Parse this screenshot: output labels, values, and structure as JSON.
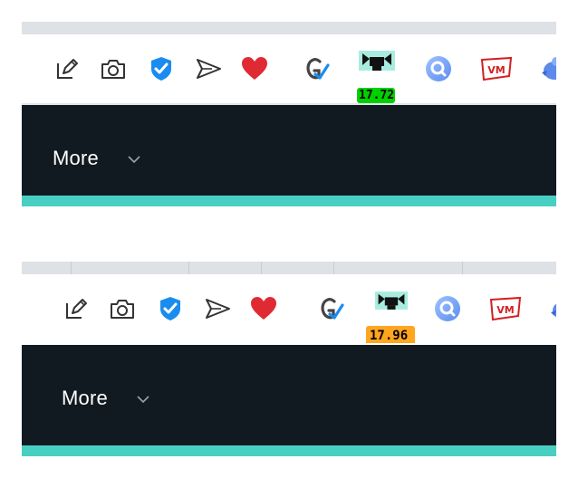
{
  "colors": {
    "navbar_bg": "#111a21",
    "accent_bar": "#47cfc1",
    "tabstrip_bg": "#dee1e6",
    "shield_blue": "#1a8cf0",
    "heart_red": "#e02a33",
    "badge_green": "#00d000",
    "badge_orange": "#ffa520"
  },
  "toolbar_icons": [
    "edit-page-icon",
    "camera-icon",
    "shield-check-icon",
    "send-icon",
    "heart-icon",
    "grammar-check-icon",
    "cat-face-icon",
    "search-circle-icon",
    "vm-icon",
    "bird-icon"
  ],
  "panels": [
    {
      "badge_value": "17.72",
      "badge_color": "#00d000",
      "nav_more_label": "More"
    },
    {
      "badge_value": "17.96",
      "badge_color": "#ffa520",
      "nav_more_label": "More"
    }
  ]
}
